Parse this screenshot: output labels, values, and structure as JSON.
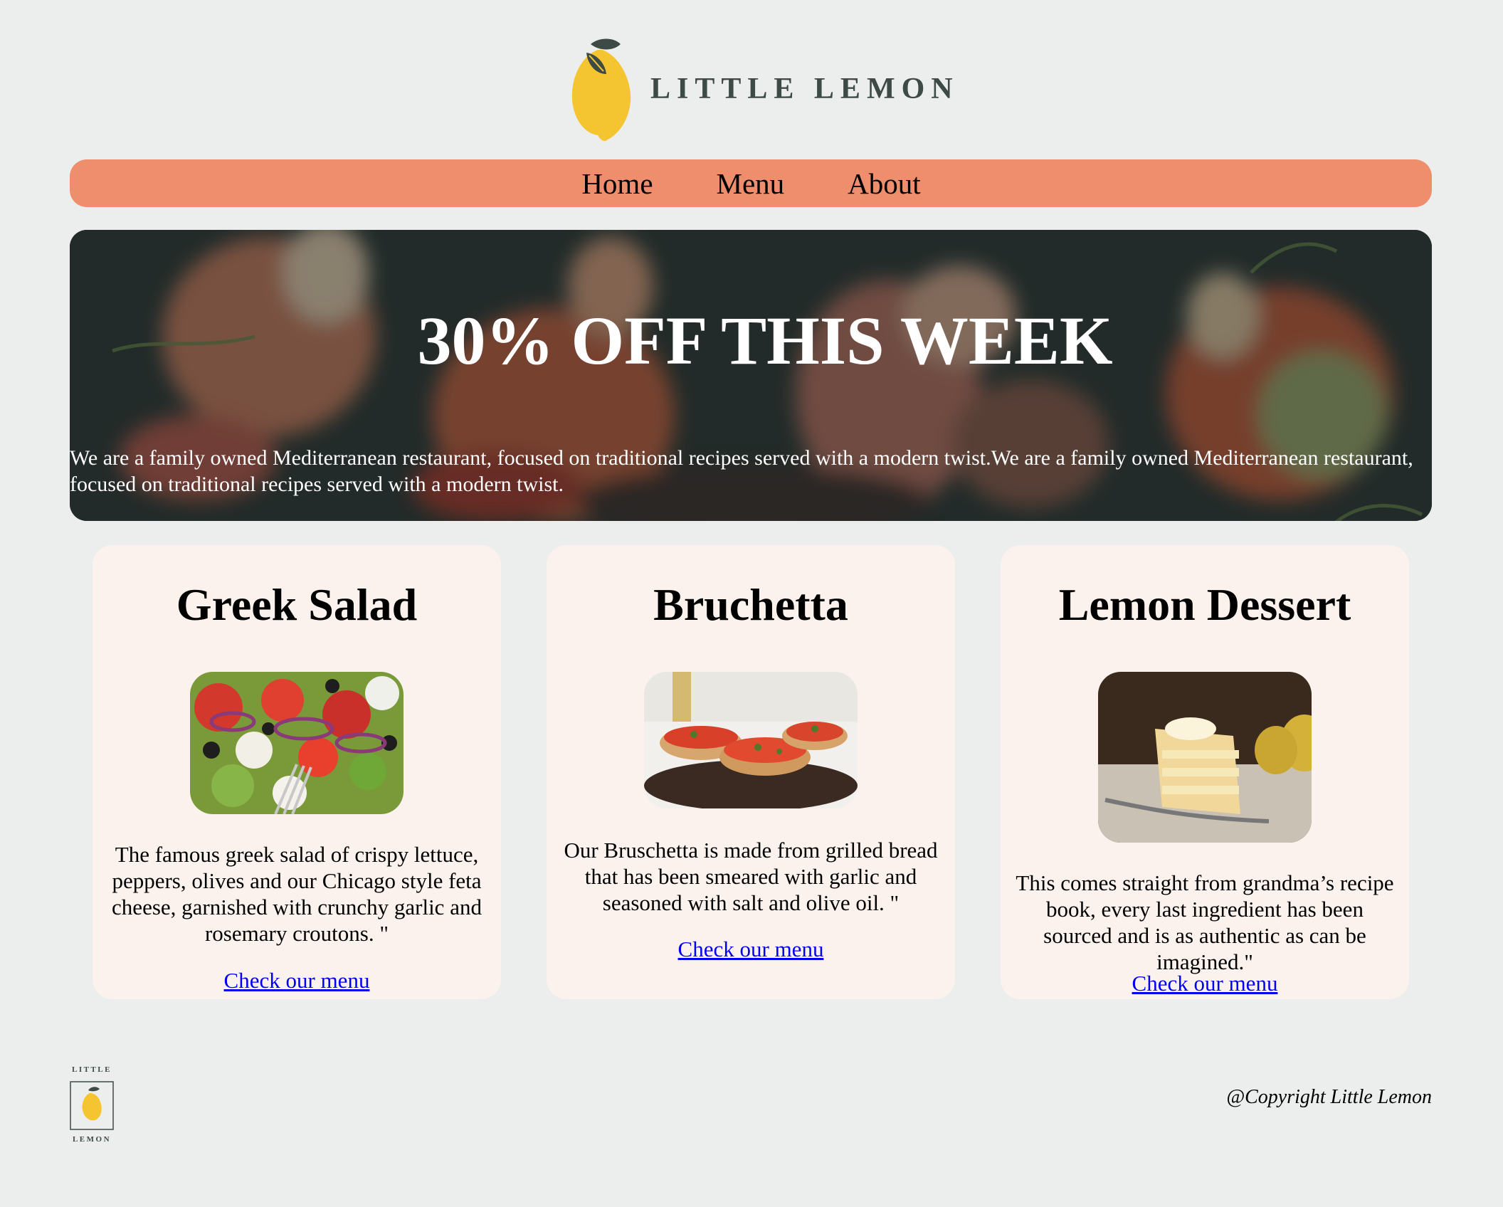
{
  "brand": {
    "name": "LITTLE LEMON",
    "footer_top": "LITTLE",
    "footer_bottom": "LEMON"
  },
  "nav": {
    "items": [
      {
        "label": "Home"
      },
      {
        "label": "Menu"
      },
      {
        "label": "About"
      }
    ]
  },
  "hero": {
    "title": "30% OFF THIS WEEK",
    "text": "We are a family owned Mediterranean restaurant, focused on traditional recipes served with a modern twist.We are a family owned Mediterranean restaurant, focused on traditional recipes served with a modern twist."
  },
  "cards": [
    {
      "title": "Greek Salad",
      "description": "The famous greek salad of crispy lettuce, peppers, olives and our Chicago style feta cheese, garnished with crunchy garlic and rosemary croutons. \"",
      "link": "Check our menu"
    },
    {
      "title": "Bruchetta",
      "description": "Our Bruschetta is made from grilled bread that has been smeared with garlic and seasoned with salt and olive oil. \"",
      "link": "Check our menu"
    },
    {
      "title": "Lemon Dessert",
      "description": "This comes straight from grandma’s recipe book, every last ingredient has been sourced and is as authentic as can be imagined.\"",
      "link": "Check our menu"
    }
  ],
  "footer": {
    "copyright": "@Copyright Little Lemon"
  },
  "colors": {
    "page_bg": "#eceeed",
    "nav_bg": "#ef8e6d",
    "card_bg": "#fbf2ed",
    "lemon": "#f4c531",
    "leaf": "#3d4a45",
    "link": "#0000ee"
  }
}
